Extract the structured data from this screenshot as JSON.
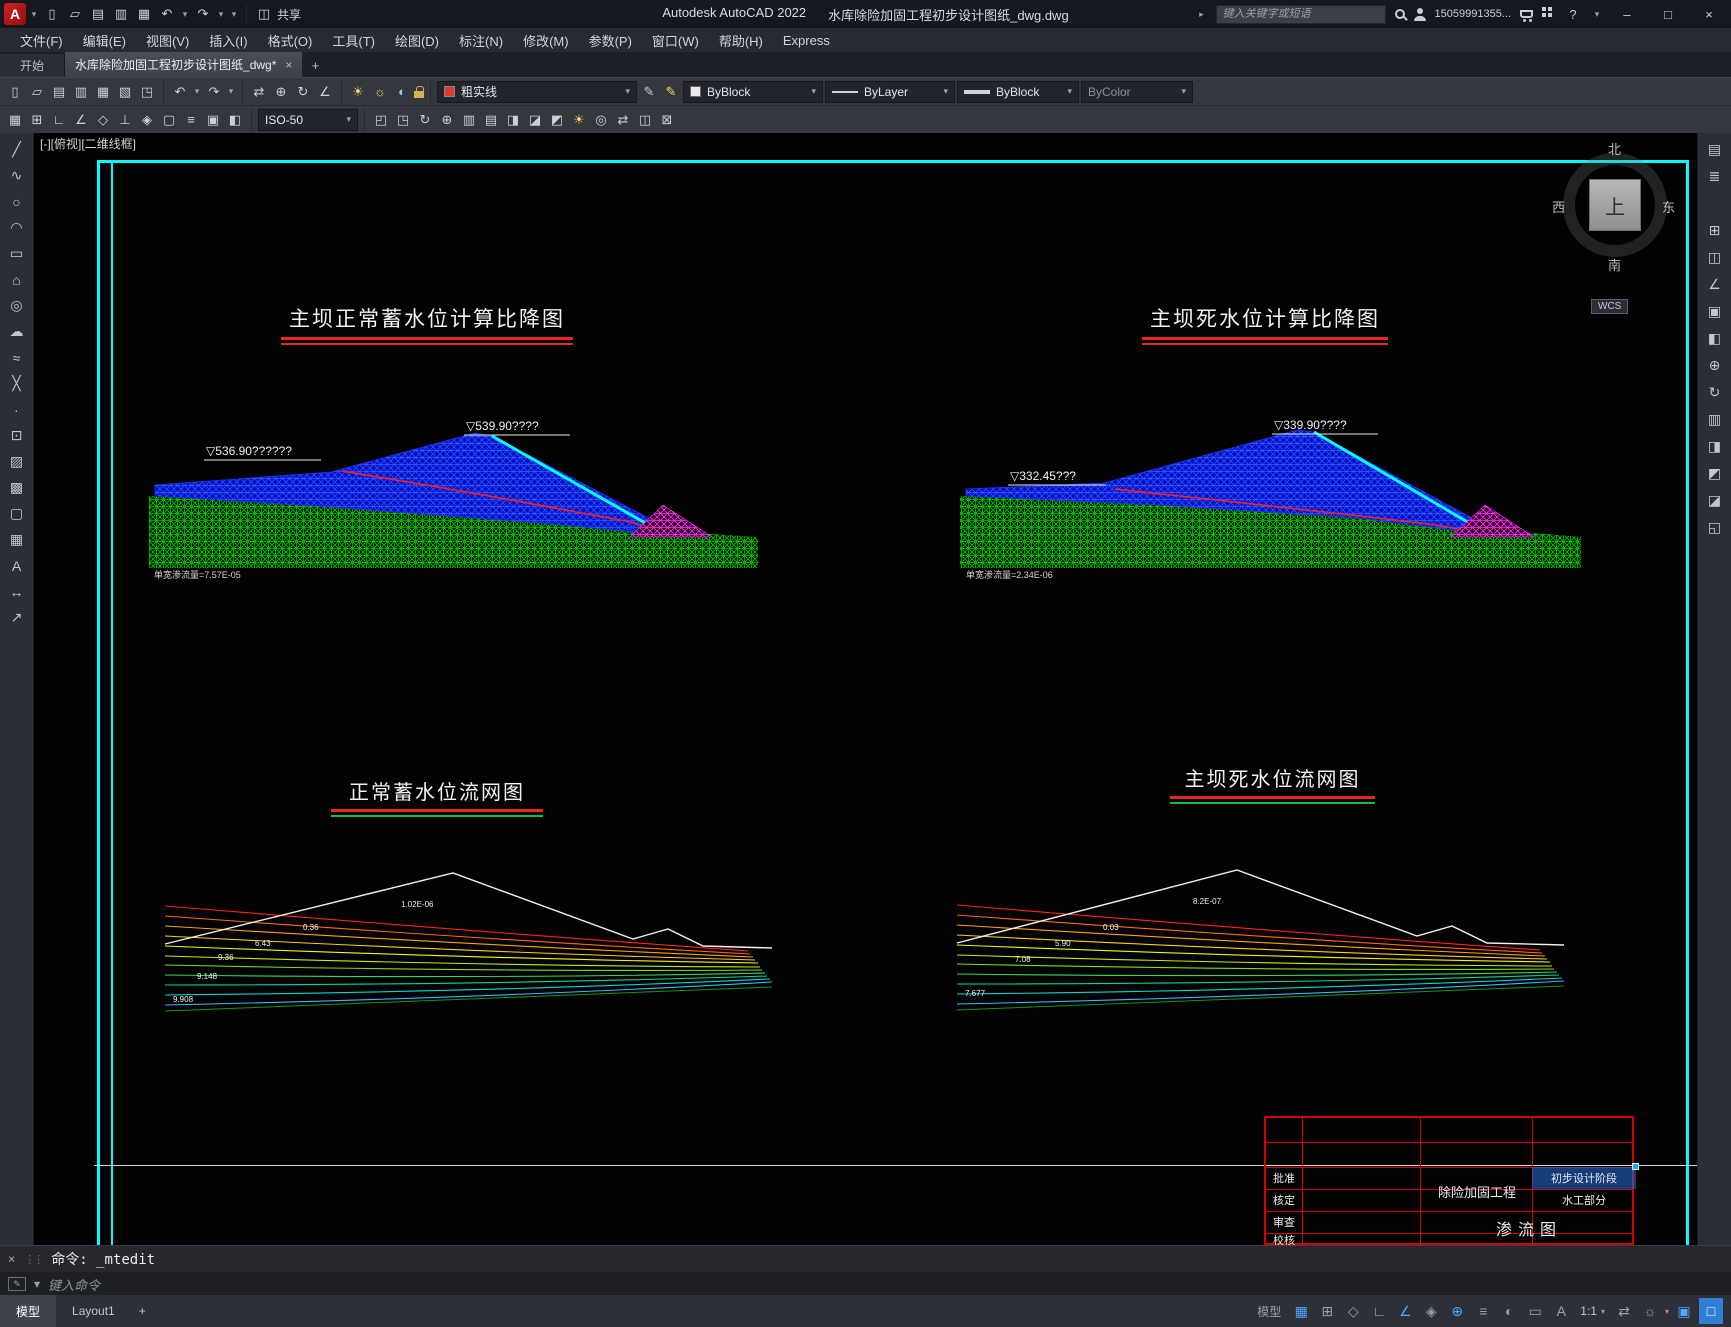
{
  "titlebar": {
    "app": "Autodesk AutoCAD 2022",
    "doc": "水库除险加固工程初步设计图纸_dwg.dwg",
    "share": "共享",
    "search_placeholder": "键入关键字或短语",
    "account": "15059991355..."
  },
  "menu": {
    "items": [
      "文件(F)",
      "编辑(E)",
      "视图(V)",
      "插入(I)",
      "格式(O)",
      "工具(T)",
      "绘图(D)",
      "标注(N)",
      "修改(M)",
      "参数(P)",
      "窗口(W)",
      "帮助(H)",
      "Express"
    ]
  },
  "tabs": {
    "start": "开始",
    "doc": "水库除险加固工程初步设计图纸_dwg*"
  },
  "ribbon": {
    "linetype": "粗实线",
    "color": "ByBlock",
    "ltype": "ByLayer",
    "lweight": "ByBlock",
    "pstyle": "ByColor",
    "iso": "ISO-50"
  },
  "viewport": {
    "controls": "[-][俯视][二维线框]"
  },
  "compass": {
    "n": "北",
    "w": "西",
    "e": "东",
    "s": "南",
    "cube": "上",
    "wcs": "WCS"
  },
  "diagrams": {
    "tl": {
      "title": "主坝正常蓄水位计算比降图",
      "wl1": "▽536.90??????",
      "wl2": "▽539.90????",
      "flow": "单宽渗流量=7.57E-05"
    },
    "tr": {
      "title": "主坝死水位计算比降图",
      "wl1": "▽332.45???",
      "wl2": "▽339.90????",
      "flow": "单宽渗流量=2.34E-06"
    },
    "bl": {
      "title": "正常蓄水位流网图",
      "labels": [
        "1.02E-06",
        "0.36",
        "6.43",
        "9.36",
        "9.148",
        "9.908"
      ]
    },
    "br": {
      "title": "主坝死水位流网图",
      "labels": [
        "8.2E-07",
        "0.03",
        "5.90",
        "7.08",
        "7.677"
      ]
    }
  },
  "titleblock": {
    "r1": "批准",
    "r2": "核定",
    "r3": "审查",
    "r4": "校核",
    "project": "除险加固工程",
    "stage": "初步设计阶段",
    "part": "水工部分",
    "sheet": "渗流图"
  },
  "cmd": {
    "history": "命令: _mtedit",
    "prompt": "键入命令",
    "grip": "⋮⋮"
  },
  "status": {
    "model_tab": "模型",
    "layout_tab": "Layout1",
    "scale": "1:1"
  },
  "icons": {
    "logo": "A",
    "new": "▯",
    "open": "▱",
    "save": "▤",
    "saveas": "▥",
    "plot": "▦",
    "preview": "▧",
    "publish": "◳",
    "undo": "↶",
    "redo": "↷",
    "caret": "▾",
    "share": "◫",
    "play": "▸",
    "help": "?",
    "min": "–",
    "max": "□",
    "close": "×",
    "plus": "+",
    "sun": "☀",
    "bulb": "☼",
    "half": "◐",
    "pencil": "✎",
    "pan": "⇄",
    "zoom": "⊕",
    "refresh": "↻",
    "measure": "∠",
    "grid": "▦",
    "snap": "⊞",
    "ortho": "∟",
    "polar": "∠",
    "osnap": "◇",
    "otrack": "⊥",
    "ducs": "◈",
    "dyn": "▢",
    "lwt": "≡",
    "qp": "▣",
    "sc": "◧",
    "ucs": "◰",
    "viewcube": "◳",
    "nav": "↻",
    "steering": "⊕",
    "sheet": "▥",
    "palette": "▤",
    "props": "◨",
    "materials": "◪",
    "render": "◩",
    "lights": "☀",
    "camera": "◎",
    "motion": "⇄",
    "layout": "◫",
    "export": "⊠",
    "line": "╱",
    "pline": "∿",
    "circle": "○",
    "arc": "◠",
    "rect": "▭",
    "polygon": "⌂",
    "ellipse": "◎",
    "hatch": "▨",
    "gradient": "▩",
    "boundary": "▢",
    "spline": "≈",
    "xline": "╳",
    "point": "∙",
    "block": "⊡",
    "table": "▦",
    "dim": "↔",
    "leader": "↗",
    "cloud": "☁",
    "transp": "◐",
    "select": "▭",
    "annot": "A",
    "switch": "⇄",
    "gear": "☼",
    "isolate": "▣",
    "clean": "□",
    "rprop": "▤",
    "rlayers": "≣",
    "rblocks": "⊞",
    "rgroups": "◫",
    "rmeasure": "∠",
    "rpaste": "▣",
    "rview": "◧",
    "rucs": "⊕",
    "rnav": "↻",
    "rsheet": "▥",
    "rpalette": "◨",
    "rrender": "◩",
    "rmaterials": "◪",
    "rvisual": "◱"
  }
}
